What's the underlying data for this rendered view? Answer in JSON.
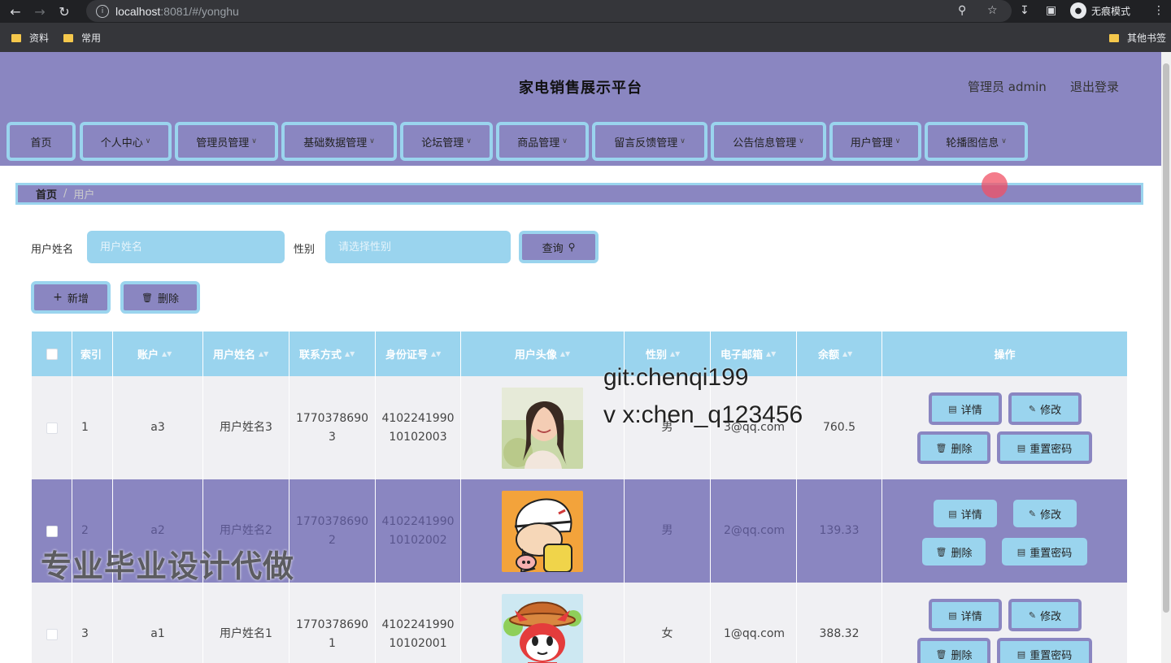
{
  "browser": {
    "url_host": "localhost",
    "url_rest": ":8081/#/yonghu",
    "incognito_label": "无痕模式",
    "bookmarks": [
      "资料",
      "常用"
    ],
    "other_bookmarks": "其他书签"
  },
  "header": {
    "title": "家电销售展示平台",
    "admin": "管理员 admin",
    "logout": "退出登录"
  },
  "menu": [
    {
      "label": "首页",
      "has_dropdown": false
    },
    {
      "label": "个人中心",
      "has_dropdown": true
    },
    {
      "label": "管理员管理",
      "has_dropdown": true
    },
    {
      "label": "基础数据管理",
      "has_dropdown": true
    },
    {
      "label": "论坛管理",
      "has_dropdown": true
    },
    {
      "label": "商品管理",
      "has_dropdown": true
    },
    {
      "label": "留言反馈管理",
      "has_dropdown": true
    },
    {
      "label": "公告信息管理",
      "has_dropdown": true
    },
    {
      "label": "用户管理",
      "has_dropdown": true
    },
    {
      "label": "轮播图信息",
      "has_dropdown": true
    }
  ],
  "breadcrumb": {
    "home": "首页",
    "current": "用户"
  },
  "search": {
    "name_label": "用户姓名",
    "name_placeholder": "用户姓名",
    "gender_label": "性别",
    "gender_placeholder": "请选择性别",
    "query_label": "查询"
  },
  "actions": {
    "add": "新增",
    "delete": "删除"
  },
  "table": {
    "headers": [
      "索引",
      "账户",
      "用户姓名",
      "联系方式",
      "身份证号",
      "用户头像",
      "性别",
      "电子邮箱",
      "余额",
      "操作"
    ],
    "rows": [
      {
        "index": "1",
        "account": "a3",
        "name": "用户姓名3",
        "phone": [
          "1770378690",
          "3"
        ],
        "id_card": [
          "4102241990",
          "10102003"
        ],
        "gender": "男",
        "email": "3@qq.com",
        "balance": "760.5",
        "avatar": "girl-photo"
      },
      {
        "index": "2",
        "account": "a2",
        "name": "用户姓名2",
        "phone": [
          "1770378690",
          "2"
        ],
        "id_card": [
          "4102241990",
          "10102002"
        ],
        "gender": "男",
        "email": "2@qq.com",
        "balance": "139.33",
        "avatar": "cartoon-boy"
      },
      {
        "index": "3",
        "account": "a1",
        "name": "用户姓名1",
        "phone": [
          "1770378690",
          "1"
        ],
        "id_card": [
          "4102241990",
          "10102001"
        ],
        "gender": "女",
        "email": "1@qq.com",
        "balance": "388.32",
        "avatar": "cartoon-fox"
      }
    ],
    "ops": {
      "detail": "详情",
      "edit": "修改",
      "delete": "删除",
      "reset": "重置密码"
    }
  },
  "watermarks": {
    "line1": "git:chenqi199",
    "line2": "v x:chen_q123456",
    "line3": "专业毕业设计代做"
  },
  "colors": {
    "primary": "#8a86c1",
    "accent": "#9ad4ee"
  }
}
